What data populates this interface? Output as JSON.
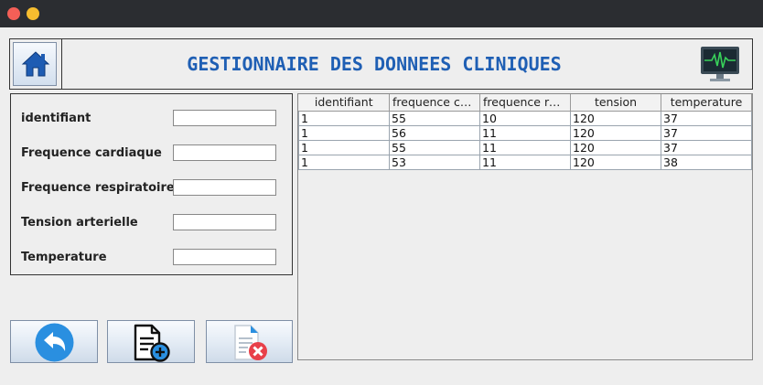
{
  "header": {
    "title": "GESTIONNAIRE DES DONNEES CLINIQUES",
    "home_icon": "home-icon",
    "monitor_icon": "heart-monitor-icon"
  },
  "form": {
    "fields": [
      {
        "label": "identifiant",
        "value": ""
      },
      {
        "label": "Frequence cardiaque",
        "value": ""
      },
      {
        "label": "Frequence respiratoire",
        "value": ""
      },
      {
        "label": "Tension arterielle",
        "value": ""
      },
      {
        "label": "Temperature",
        "value": ""
      }
    ]
  },
  "actions": [
    {
      "name": "back-button",
      "icon": "undo-arrow-icon"
    },
    {
      "name": "add-record-button",
      "icon": "add-document-icon"
    },
    {
      "name": "delete-record-button",
      "icon": "delete-document-icon"
    }
  ],
  "table": {
    "columns": [
      "identifiant",
      "frequence cardiaque",
      "frequence respiratoire",
      "tension",
      "temperature"
    ],
    "rows": [
      [
        "1",
        "55",
        "10",
        "120",
        "37"
      ],
      [
        "1",
        "56",
        "11",
        "120",
        "37"
      ],
      [
        "1",
        "55",
        "11",
        "120",
        "37"
      ],
      [
        "1",
        "53",
        "11",
        "120",
        "38"
      ]
    ]
  },
  "colors": {
    "title": "#1f5fb4",
    "titlebar": "#2b2d31",
    "close": "#f45f57",
    "minimize": "#f6bd2f"
  }
}
